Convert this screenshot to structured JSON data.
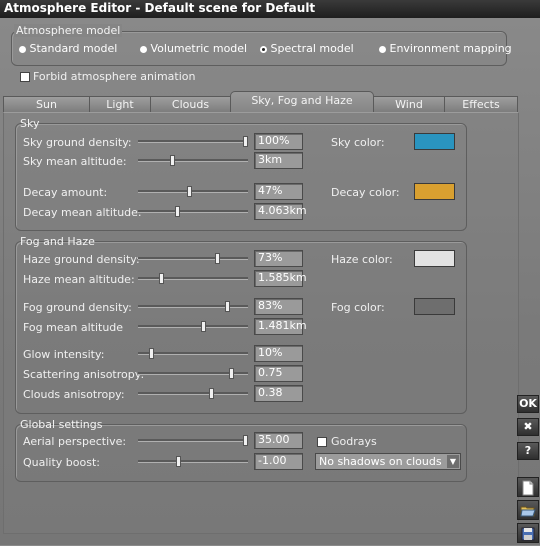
{
  "window": {
    "title": "Atmosphere Editor - Default scene for Default"
  },
  "model": {
    "label": "Atmosphere model",
    "options": [
      "Standard model",
      "Volumetric model",
      "Spectral model",
      "Environment mapping"
    ],
    "selected": 2
  },
  "forbid_animation": {
    "label": "Forbid atmosphere animation",
    "checked": false
  },
  "tabs": [
    "Sun",
    "Light",
    "Clouds",
    "Sky, Fog and Haze",
    "Wind",
    "Effects"
  ],
  "active_tab": 3,
  "sky": {
    "title": "Sky",
    "ground_density": {
      "label": "Sky ground density:",
      "value": "100%",
      "level": 1.0
    },
    "mean_altitude": {
      "label": "Sky mean altitude:",
      "value": "3km",
      "level": 0.3
    },
    "decay_amount": {
      "label": "Decay amount:",
      "value": "47%",
      "level": 0.47
    },
    "decay_mean_altitude": {
      "label": "Decay mean altitude:",
      "value": "4.063km",
      "level": 0.35
    },
    "sky_color": {
      "label": "Sky color:",
      "color": "#2a94bf"
    },
    "decay_color": {
      "label": "Decay color:",
      "color": "#d9a030"
    }
  },
  "fog": {
    "title": "Fog and Haze",
    "haze_ground_density": {
      "label": "Haze ground density:",
      "value": "73%",
      "level": 0.73
    },
    "haze_mean_altitude": {
      "label": "Haze mean altitude:",
      "value": "1.585km",
      "level": 0.2
    },
    "fog_ground_density": {
      "label": "Fog ground density:",
      "value": "83%",
      "level": 0.83
    },
    "fog_mean_altitude": {
      "label": "Fog mean altitude",
      "value": "1.481km",
      "level": 0.6
    },
    "glow_intensity": {
      "label": "Glow intensity:",
      "value": "10%",
      "level": 0.1
    },
    "scattering_anisotropy": {
      "label": "Scattering anisotropy:",
      "value": "0.75",
      "level": 0.87
    },
    "clouds_anisotropy": {
      "label": "Clouds anisotropy:",
      "value": "0.38",
      "level": 0.68
    },
    "haze_color": {
      "label": "Haze color:",
      "color": "#e2e2e2"
    },
    "fog_color": {
      "label": "Fog color:",
      "color": "#6e6e6e"
    }
  },
  "global": {
    "title": "Global settings",
    "aerial_perspective": {
      "label": "Aerial perspective:",
      "value": "35.00",
      "level": 1.0
    },
    "quality_boost": {
      "label": "Quality boost:",
      "value": "-1.00",
      "level": 0.36
    },
    "godrays": {
      "label": "Godrays",
      "checked": false
    },
    "shadows": {
      "value": "No shadows on clouds"
    }
  },
  "side_buttons": {
    "ok": "OK",
    "cancel": "✖",
    "help": "?"
  },
  "icons": [
    "new-document-icon",
    "open-folder-icon",
    "save-disk-icon"
  ]
}
